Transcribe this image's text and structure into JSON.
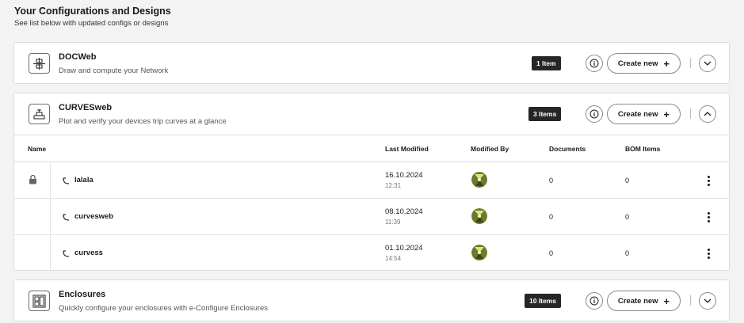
{
  "header": {
    "title": "Your Configurations and Designs",
    "subtitle": "See list below with updated configs or designs"
  },
  "cards": [
    {
      "title": "DOCWeb",
      "description": "Draw and compute your Network",
      "badge": "1 Item",
      "create_label": "Create new",
      "expanded": false,
      "icon": "network-diagram-icon"
    },
    {
      "title": "CURVESweb",
      "description": "Plot and verify your devices trip curves at a glance",
      "badge": "3 Items",
      "create_label": "Create new",
      "expanded": true,
      "icon": "curves-device-icon",
      "table": {
        "columns": [
          "Name",
          "Last Modified",
          "Modified By",
          "Documents",
          "BOM Items"
        ],
        "rows": [
          {
            "name": "lalala",
            "date": "16.10.2024",
            "time": "12:31",
            "documents": "0",
            "bom": "0",
            "locked": true
          },
          {
            "name": "curvesweb",
            "date": "08.10.2024",
            "time": "11:39",
            "documents": "0",
            "bom": "0",
            "locked": false
          },
          {
            "name": "curvess",
            "date": "01.10.2024",
            "time": "14:54",
            "documents": "0",
            "bom": "0",
            "locked": false
          }
        ]
      }
    },
    {
      "title": "Enclosures",
      "description": "Quickly configure your enclosures with e-Configure Enclosures",
      "badge": "10 Items",
      "create_label": "Create new",
      "expanded": false,
      "icon": "enclosure-icon"
    }
  ],
  "colors": {
    "badge_bg": "#262626",
    "background": "#f3f3f3",
    "card_bg": "#ffffff"
  }
}
